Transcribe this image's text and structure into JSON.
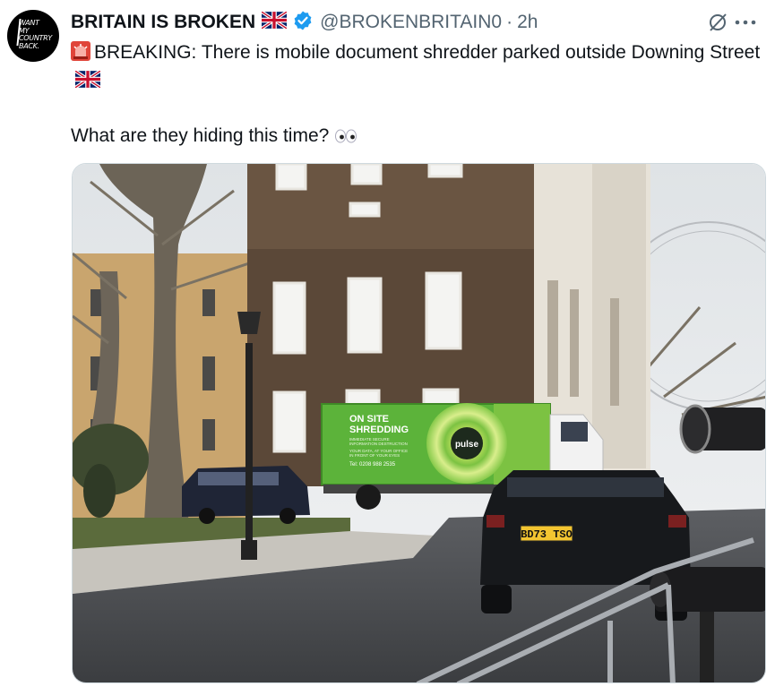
{
  "post": {
    "author_name": "BRITAIN IS BROKEN",
    "handle": "@BROKENBRITAIN0",
    "separator": "·",
    "time": "2h",
    "text_line1": "BREAKING: There is mobile document shredder parked outside Downing Street",
    "text_line2": "What are they hiding this time?",
    "avatar_logo_lines": [
      "WANT",
      "MY",
      "COUNTRY",
      "BACK."
    ]
  },
  "photo": {
    "truck_lines": [
      "ON SITE",
      "SHREDDING"
    ],
    "truck_small": [
      "IMMEDIATE SECURE",
      "INFORMATION DESTRUCTION",
      "YOUR DATA, AT YOUR OFFICE",
      "IN FRONT OF YOUR EYES"
    ],
    "truck_phone": "Tel: 0208 988 2535",
    "truck_brand": "pulse",
    "number_plate": "BD73 TSO"
  },
  "icons": [
    "verified-badge-icon",
    "uk-flag-icon",
    "siren-icon",
    "eyes-icon",
    "grok-icon",
    "more-icon"
  ],
  "colors": {
    "verified": "#1d9bf0",
    "handle": "#536471",
    "truck_green": "#5cb33a"
  }
}
